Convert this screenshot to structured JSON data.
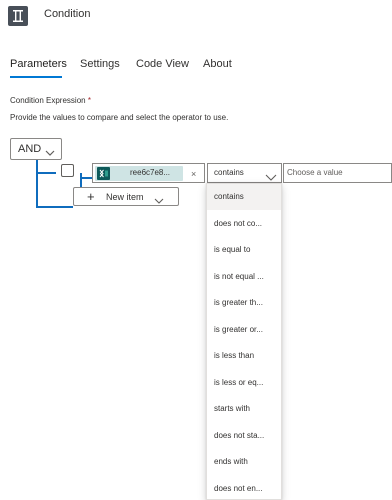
{
  "header": {
    "title": "Condition",
    "icon": "condition-icon"
  },
  "tabs": [
    {
      "label": "Parameters",
      "active": true
    },
    {
      "label": "Settings",
      "active": false
    },
    {
      "label": "Code View",
      "active": false
    },
    {
      "label": "About",
      "active": false
    }
  ],
  "form": {
    "condition_label": "Condition Expression",
    "required_mark": "*",
    "help_text": "Provide the values to compare and select the operator to use.",
    "group_operator": "AND",
    "row": {
      "token_label": "ree6c7e8...",
      "token_icon": "excel-icon",
      "token_close": "×",
      "operator": "contains",
      "value_placeholder": "Choose a value"
    },
    "new_item_label": "New item"
  },
  "operator_options": [
    "contains",
    "does not co...",
    "is equal to",
    "is not equal ...",
    "is greater th...",
    "is greater or...",
    "is less than",
    "is less or eq...",
    "starts with",
    "does not sta...",
    "ends with",
    "does not en..."
  ],
  "colors": {
    "accent": "#0078d4",
    "tree_line": "#0f6cbd",
    "token_bg": "#cfe4e4",
    "required": "#a4262c"
  }
}
